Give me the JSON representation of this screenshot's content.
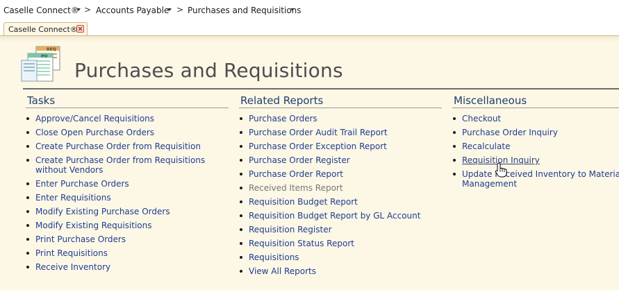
{
  "breadcrumb": {
    "items": [
      "Caselle Connect®",
      "Accounts Payable",
      "Purchases and Requisitions"
    ],
    "separator": ">"
  },
  "tab": {
    "label": "Caselle Connect®"
  },
  "page": {
    "title": "Purchases and Requisitions",
    "icon_labels": [
      "REQ",
      "PO"
    ]
  },
  "columns": {
    "tasks": {
      "heading": "Tasks",
      "items": [
        [
          "Approve/Cancel Requisitions"
        ],
        [
          "Close Open Purchase Orders"
        ],
        [
          "Create Purchase Order from Requisition"
        ],
        [
          "Create Purchase Order from Requisitions",
          "without Vendors"
        ],
        [
          "Enter Purchase Orders"
        ],
        [
          "Enter Requisitions"
        ],
        [
          "Modify Existing Purchase Orders"
        ],
        [
          "Modify Existing Requisitions"
        ],
        [
          "Print Purchase Orders"
        ],
        [
          "Print Requisitions"
        ],
        [
          "Receive Inventory"
        ]
      ]
    },
    "reports": {
      "heading": "Related Reports",
      "items": [
        [
          "Purchase Orders"
        ],
        [
          "Purchase Order Audit Trail Report"
        ],
        [
          "Purchase Order Exception Report"
        ],
        [
          "Purchase Order Register"
        ],
        [
          "Purchase Order Report"
        ],
        [
          "Received Items Report"
        ],
        [
          "Requisition Budget Report"
        ],
        [
          "Requisition Budget Report by GL Account"
        ],
        [
          "Requisition Register"
        ],
        [
          "Requisition Status Report"
        ],
        [
          "Requisitions"
        ],
        [
          "View All Reports"
        ]
      ],
      "disabled_index": 5
    },
    "misc": {
      "heading": "Miscellaneous",
      "items": [
        [
          "Checkout"
        ],
        [
          "Purchase Order Inquiry"
        ],
        [
          "Recalculate"
        ],
        [
          "Requisition Inquiry"
        ],
        [
          "Update Received Inventory to Materials",
          "Management"
        ]
      ],
      "hover_index": 3
    }
  },
  "colors": {
    "link": "#1e3d8f",
    "heading": "#1e3d6b",
    "disabled": "#777777",
    "background": "#fdf7e6",
    "tab_border": "#c9b98a"
  }
}
